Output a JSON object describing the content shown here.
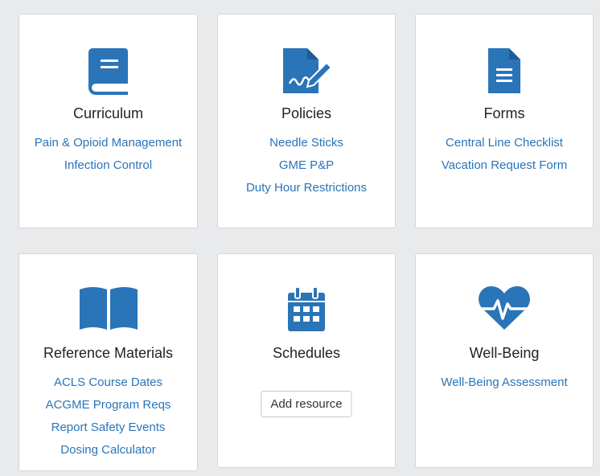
{
  "colors": {
    "accent": "#2a74b8",
    "link": "#2a74b8",
    "card_border": "#d3d6da",
    "background": "#e9eaec"
  },
  "cards": [
    {
      "title": "Curriculum",
      "icon": "book-icon",
      "links": [
        "Pain & Opioid Management",
        "Infection Control"
      ]
    },
    {
      "title": "Policies",
      "icon": "signed-document-icon",
      "links": [
        "Needle Sticks",
        "GME P&P",
        "Duty Hour Restrictions"
      ]
    },
    {
      "title": "Forms",
      "icon": "document-icon",
      "links": [
        "Central Line Checklist",
        "Vacation Request Form"
      ]
    },
    {
      "title": "Reference Materials",
      "icon": "open-book-icon",
      "links": [
        "ACLS Course Dates",
        "ACGME Program Reqs",
        "Report Safety Events",
        "Dosing Calculator"
      ]
    },
    {
      "title": "Schedules",
      "icon": "calendar-icon",
      "links": [],
      "button_label": "Add resource"
    },
    {
      "title": "Well-Being",
      "icon": "heartbeat-icon",
      "links": [
        "Well-Being Assessment"
      ]
    }
  ]
}
